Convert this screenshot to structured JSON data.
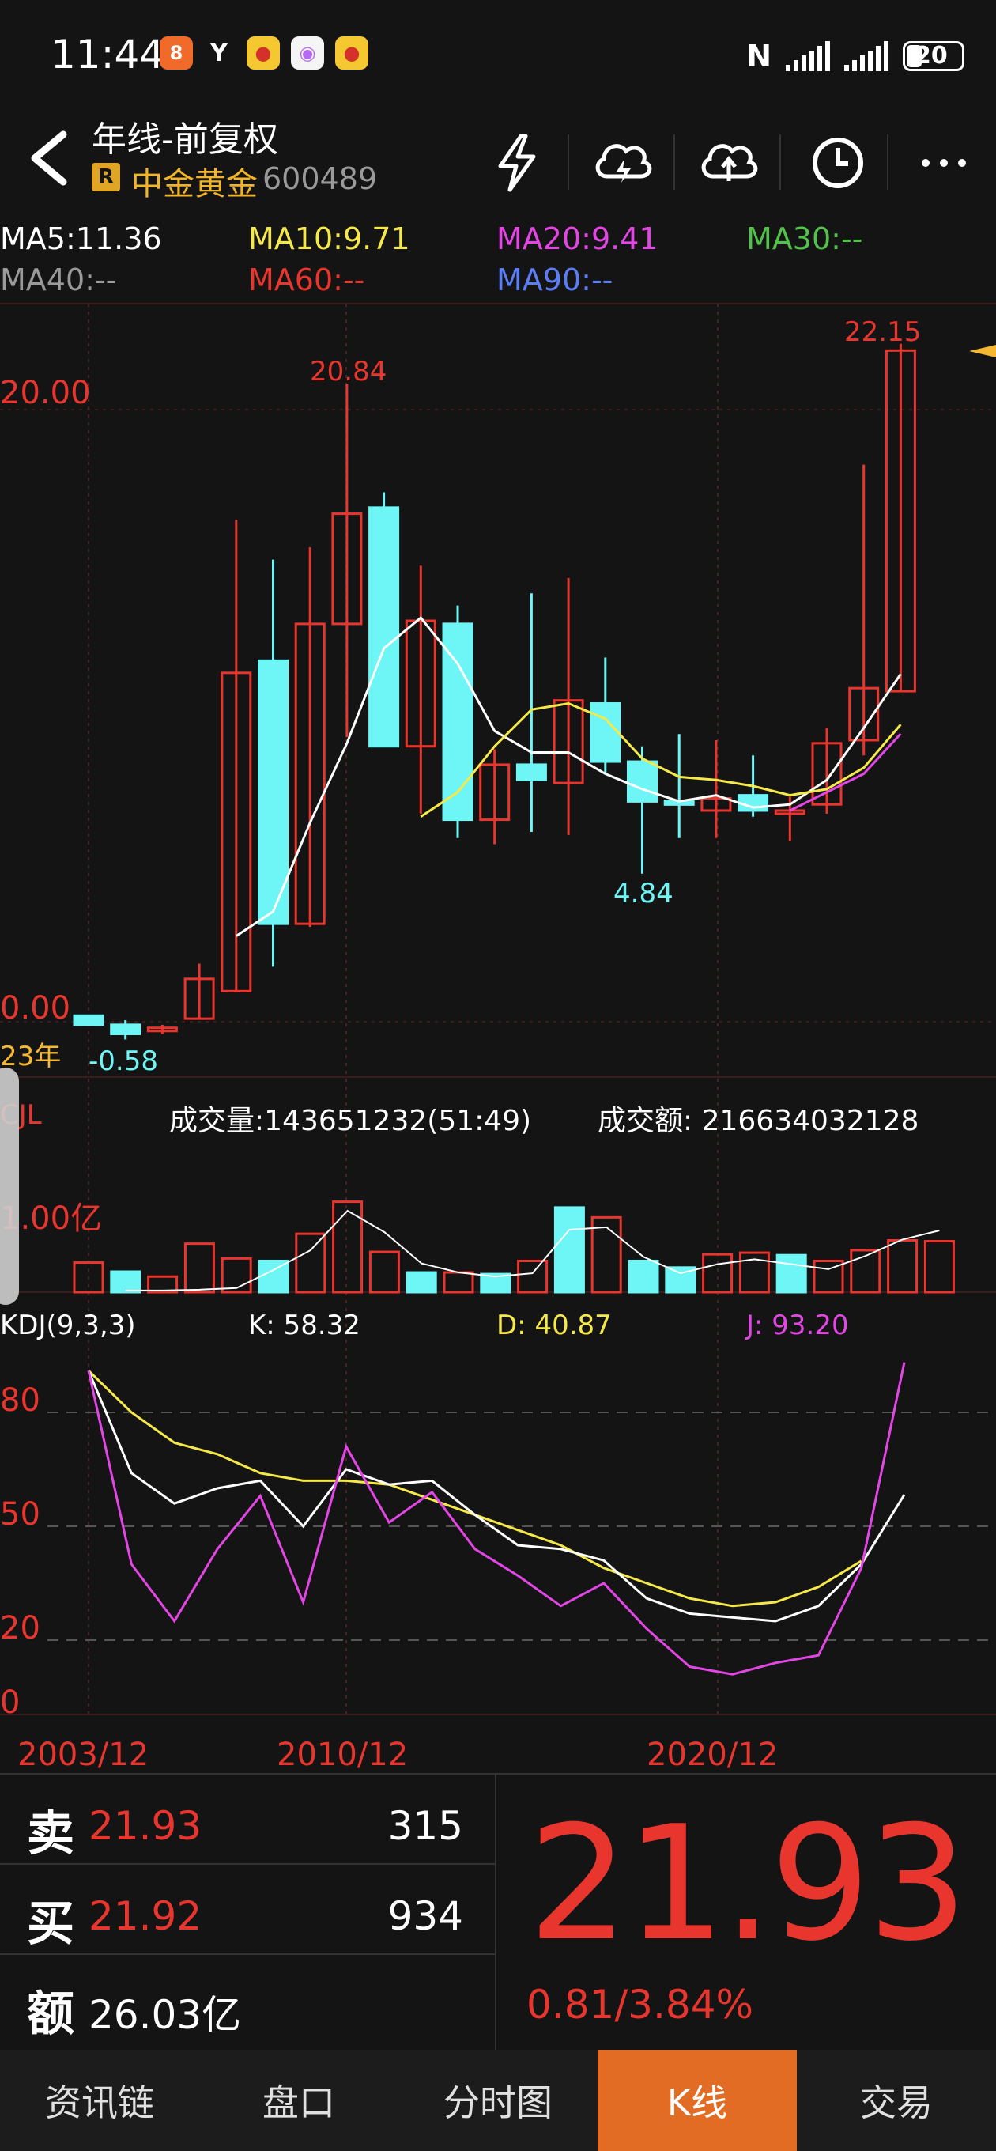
{
  "status": {
    "time": "11:44",
    "battery": "20",
    "network": "N"
  },
  "header": {
    "title": "年线-前复权",
    "badge": "R",
    "stock_name": "中金黄金",
    "stock_code": "600489"
  },
  "ma": {
    "ma5": "MA5:11.36",
    "ma10": "MA10:9.71",
    "ma20": "MA20:9.41",
    "ma30": "MA30:--",
    "ma40": "MA40:--",
    "ma60": "MA60:--",
    "ma90": "MA90:--"
  },
  "colors": {
    "up": "#e8362e",
    "down": "#6ef5f5",
    "ma5": "#ffffff",
    "ma10": "#f5e94a",
    "ma20": "#e446e6",
    "ma30": "#52c24a",
    "ma90": "#5b7df5",
    "k": "#ffffff",
    "d": "#f5e94a",
    "j": "#e446e6"
  },
  "chart_data": {
    "type": "candlestick",
    "price_axis": {
      "ticks": [
        "20.00",
        "0.00"
      ],
      "ylim": [
        0,
        20
      ]
    },
    "first_label": "23年",
    "annotations": {
      "high": "20.84",
      "low": "4.84",
      "last_high": "22.15",
      "start_low": "-0.58"
    },
    "candles": [
      {
        "o": 0.2,
        "c": -0.1,
        "h": 0.2,
        "l": -0.1
      },
      {
        "o": -0.1,
        "c": -0.4,
        "h": 0.05,
        "l": -0.58
      },
      {
        "o": -0.3,
        "c": -0.2,
        "h": -0.1,
        "l": -0.4
      },
      {
        "o": 0.1,
        "c": 1.4,
        "h": 1.9,
        "l": 0.1
      },
      {
        "o": 1.0,
        "c": 11.4,
        "h": 16.4,
        "l": 1.0
      },
      {
        "o": 11.8,
        "c": 3.2,
        "h": 15.1,
        "l": 1.8
      },
      {
        "o": 3.2,
        "c": 13.0,
        "h": 15.5,
        "l": 3.1
      },
      {
        "o": 13.0,
        "c": 16.6,
        "h": 20.84,
        "l": 9.3
      },
      {
        "o": 16.8,
        "c": 9.0,
        "h": 17.3,
        "l": 9.0
      },
      {
        "o": 9.0,
        "c": 13.1,
        "h": 14.9,
        "l": 6.8
      },
      {
        "o": 13.0,
        "c": 6.6,
        "h": 13.6,
        "l": 6.0
      },
      {
        "o": 6.6,
        "c": 8.4,
        "h": 8.9,
        "l": 5.8
      },
      {
        "o": 8.4,
        "c": 7.9,
        "h": 14.0,
        "l": 6.2
      },
      {
        "o": 7.8,
        "c": 10.5,
        "h": 14.5,
        "l": 6.1
      },
      {
        "o": 10.4,
        "c": 8.5,
        "h": 11.9,
        "l": 8.1
      },
      {
        "o": 8.5,
        "c": 7.2,
        "h": 9.0,
        "l": 4.84
      },
      {
        "o": 7.2,
        "c": 7.1,
        "h": 9.4,
        "l": 6.0
      },
      {
        "o": 6.9,
        "c": 7.3,
        "h": 9.2,
        "l": 6.0
      },
      {
        "o": 7.4,
        "c": 6.9,
        "h": 8.7,
        "l": 6.7
      },
      {
        "o": 6.8,
        "c": 6.9,
        "h": 7.4,
        "l": 5.9
      },
      {
        "o": 7.1,
        "c": 9.1,
        "h": 9.6,
        "l": 6.8
      },
      {
        "o": 9.2,
        "c": 10.9,
        "h": 18.2,
        "l": 8.7
      },
      {
        "o": 10.8,
        "c": 21.93,
        "h": 22.15,
        "l": 10.8
      }
    ],
    "ma5": [
      null,
      null,
      null,
      null,
      2.8,
      3.6,
      6.5,
      9.1,
      12.2,
      13.2,
      11.7,
      9.5,
      8.8,
      8.8,
      8.1,
      7.6,
      7.2,
      7.4,
      7.0,
      7.1,
      7.9,
      9.6,
      11.36
    ],
    "ma10": [
      null,
      null,
      null,
      null,
      null,
      null,
      null,
      null,
      null,
      6.7,
      7.5,
      9.0,
      10.2,
      10.4,
      9.9,
      8.6,
      8.0,
      7.9,
      7.7,
      7.4,
      7.6,
      8.3,
      9.71
    ],
    "ma20": [
      null,
      null,
      null,
      null,
      null,
      null,
      null,
      null,
      null,
      null,
      null,
      null,
      null,
      null,
      null,
      null,
      null,
      null,
      null,
      6.9,
      7.5,
      8.1,
      9.41
    ],
    "volume": {
      "label_cjl": "CJL",
      "label_vol": "成交量:143651232(51:49)",
      "label_amt": "成交额: 216634032128",
      "tick": "1.00亿",
      "values": [
        0.36,
        0.25,
        0.19,
        0.59,
        0.41,
        0.38,
        0.71,
        1.1,
        0.49,
        0.24,
        0.24,
        0.22,
        0.38,
        1.03,
        0.91,
        0.38,
        0.3,
        0.46,
        0.48,
        0.45,
        0.38,
        0.51,
        0.63,
        0.62
      ],
      "directions": [
        "up",
        "down",
        "up",
        "up",
        "up",
        "down",
        "up",
        "up",
        "up",
        "down",
        "up",
        "down",
        "up",
        "down",
        "up",
        "down",
        "down",
        "up",
        "up",
        "down",
        "up",
        "up",
        "up",
        "up"
      ],
      "ma_line": [
        null,
        0.02,
        0.02,
        0.03,
        0.05,
        0.27,
        0.51,
        0.99,
        0.73,
        0.35,
        0.24,
        0.19,
        0.23,
        0.76,
        0.79,
        0.43,
        0.23,
        0.34,
        0.4,
        0.34,
        0.28,
        0.44,
        0.64,
        0.75
      ]
    },
    "kdj": {
      "label": "KDJ(9,3,3)",
      "k_label": "K: 58.32",
      "d_label": "D: 40.87",
      "j_label": "J: 93.20",
      "ticks": [
        "80",
        "50",
        "20",
        "0"
      ],
      "k": [
        91,
        64,
        56,
        60,
        62,
        50,
        65,
        61,
        62,
        53,
        45,
        44,
        41,
        31,
        27,
        26,
        25,
        29,
        40,
        58.32
      ],
      "d": [
        91,
        80,
        72,
        69,
        64,
        62,
        62,
        61,
        57,
        53,
        49,
        45,
        39,
        35,
        31,
        29,
        30,
        34,
        40.87
      ],
      "j": [
        91,
        40,
        25,
        44,
        58,
        30,
        71,
        51,
        59,
        44,
        37,
        29,
        35,
        23,
        13,
        11,
        14,
        16,
        39,
        93.2
      ]
    },
    "x_ticks": [
      "2003/12",
      "2010/12",
      "2020/12"
    ]
  },
  "quote": {
    "sell_label": "卖",
    "sell_price": "21.93",
    "sell_vol": "315",
    "buy_label": "买",
    "buy_price": "21.92",
    "buy_vol": "934",
    "amount_label": "额",
    "amount": "26.03亿",
    "last_price": "21.93",
    "change": "0.81/3.84%"
  },
  "tabs": [
    "资讯链",
    "盘口",
    "分时图",
    "K线",
    "交易"
  ],
  "active_tab": "K线"
}
